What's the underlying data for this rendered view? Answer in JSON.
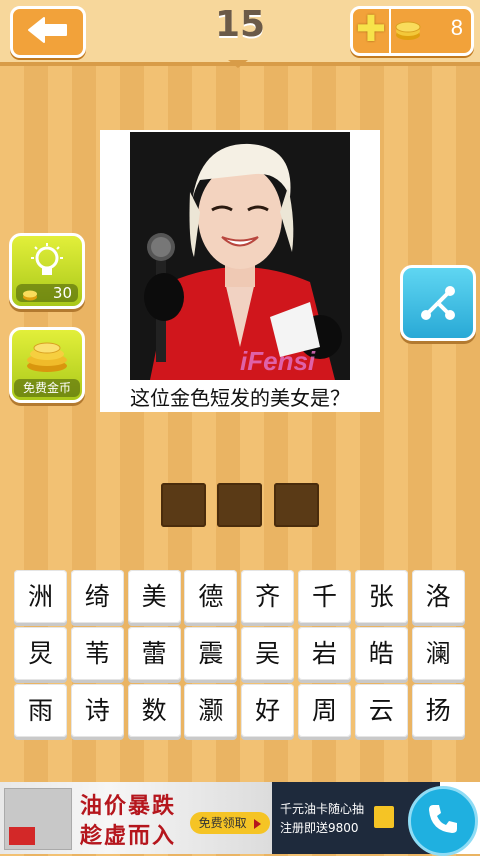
{
  "header": {
    "level": "15",
    "coins": "8"
  },
  "puzzle": {
    "question": "这位金色短发的美女是？",
    "image_watermark": "iFensi",
    "answer_slots": [
      "",
      "",
      ""
    ]
  },
  "side_buttons": {
    "hint_cost": "30",
    "free_coins_label": "免费金币"
  },
  "keyboard": {
    "rows": [
      [
        "洲",
        "绮",
        "美",
        "德",
        "齐",
        "千",
        "张",
        "洛"
      ],
      [
        "炅",
        "苇",
        "蕾",
        "震",
        "吴",
        "岩",
        "皓",
        "澜"
      ],
      [
        "雨",
        "诗",
        "数",
        "灏",
        "好",
        "周",
        "云",
        "扬"
      ]
    ]
  },
  "ad": {
    "headline_line1": "油价暴跌",
    "headline_line2": "趁虚而入",
    "cta": "免费领取",
    "right_line1": "千元油卡随心抽",
    "right_line2": "注册即送9800"
  },
  "colors": {
    "accent_orange": "#f2a23a",
    "hint_green": "#a9c81a",
    "share_blue": "#29a9d6",
    "slot_brown": "#5a3a16"
  }
}
